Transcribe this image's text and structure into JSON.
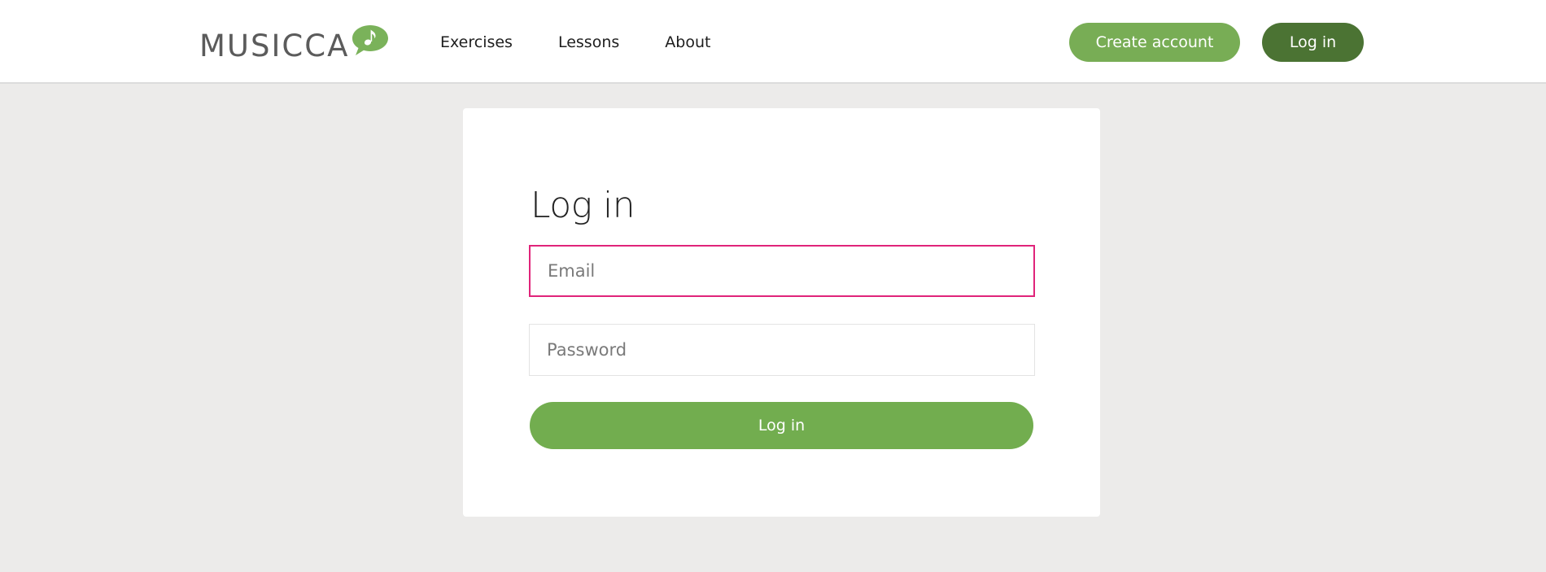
{
  "brand": {
    "name": "MUSICCA",
    "logo_color": "#5b5b5b",
    "bubble_color": "#7ab25a",
    "bubble_icon": "music-note-bubble-icon"
  },
  "nav": {
    "items": [
      {
        "label": "Exercises"
      },
      {
        "label": "Lessons"
      },
      {
        "label": "About"
      }
    ]
  },
  "header_actions": {
    "create_account_label": "Create account",
    "create_account_color": "#78ad55",
    "login_label": "Log in",
    "login_color": "#4b7333"
  },
  "login_form": {
    "title": "Log in",
    "email_placeholder": "Email",
    "email_value": "",
    "email_focus_border_color": "#e0247a",
    "password_placeholder": "Password",
    "password_value": "",
    "submit_label": "Log in",
    "submit_color": "#72ad4f"
  },
  "colors": {
    "page_background": "#ecebea",
    "header_background": "#ffffff",
    "card_background": "#ffffff"
  }
}
